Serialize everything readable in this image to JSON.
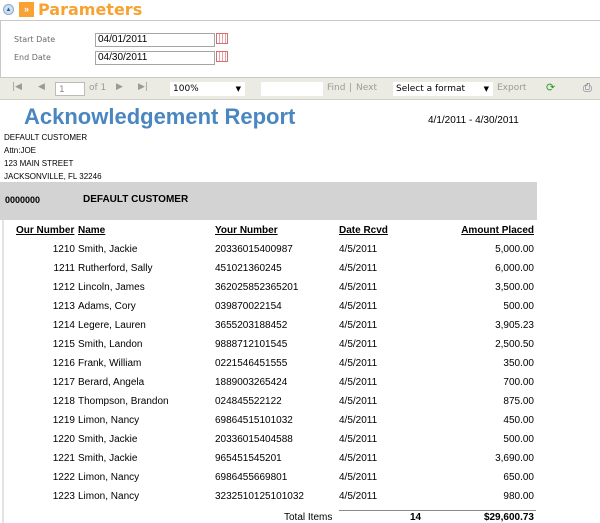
{
  "parameters": {
    "title": "Parameters",
    "start_label": "Start Date",
    "start_value": "04/01/2011",
    "end_label": "End Date",
    "end_value": "04/30/2011"
  },
  "toolbar": {
    "page": "1",
    "of": "of 1",
    "zoom": "100%",
    "find": "Find",
    "sep": "|",
    "next": "Next",
    "format": "Select a format",
    "export": "Export",
    "icons": [
      "first-page",
      "prev-page",
      "next-page",
      "last-page",
      "refresh",
      "print"
    ]
  },
  "report": {
    "title": "Acknowledgement Report",
    "date_range": "4/1/2011 - 4/30/2011",
    "title_color": "#4a86c0",
    "address": [
      "DEFAULT CUSTOMER",
      "Attn:JOE",
      "123 MAIN STREET",
      "JACKSONVILLE, FL 32246"
    ],
    "group_code": "0000000",
    "group_name": "DEFAULT CUSTOMER",
    "columns": [
      "Our Number",
      "Name",
      "Your Number",
      "Date Rcvd",
      "Amount Placed"
    ],
    "rows": [
      [
        "1210",
        "Smith, Jackie",
        "20336015400987",
        "4/5/2011",
        "5,000.00"
      ],
      [
        "1211",
        "Rutherford, Sally",
        "451021360245",
        "4/5/2011",
        "6,000.00"
      ],
      [
        "1212",
        "Lincoln, James",
        "362025852365201",
        "4/5/2011",
        "3,500.00"
      ],
      [
        "1213",
        "Adams, Cory",
        "039870022154",
        "4/5/2011",
        "500.00"
      ],
      [
        "1214",
        "Legere, Lauren",
        "3655203188452",
        "4/5/2011",
        "3,905.23"
      ],
      [
        "1215",
        "Smith, Landon",
        "9888712101545",
        "4/5/2011",
        "2,500.50"
      ],
      [
        "1216",
        "Frank, William",
        "0221546451555",
        "4/5/2011",
        "350.00"
      ],
      [
        "1217",
        "Berard, Angela",
        "1889003265424",
        "4/5/2011",
        "700.00"
      ],
      [
        "1218",
        "Thompson, Brandon",
        "024845522122",
        "4/5/2011",
        "875.00"
      ],
      [
        "1219",
        "Limon, Nancy",
        "69864515101032",
        "4/5/2011",
        "450.00"
      ],
      [
        "1220",
        "Smith, Jackie",
        "20336015404588",
        "4/5/2011",
        "500.00"
      ],
      [
        "1221",
        "Smith, Jackie",
        "965451545201",
        "4/5/2011",
        "3,690.00"
      ],
      [
        "1222",
        "Limon, Nancy",
        "6986455669801",
        "4/5/2011",
        "650.00"
      ],
      [
        "1223",
        "Limon, Nancy",
        "3232510125101032",
        "4/5/2011",
        "980.00"
      ]
    ],
    "total_label": "Total Items",
    "total_count": "14",
    "total_amount": "$29,600.73"
  }
}
